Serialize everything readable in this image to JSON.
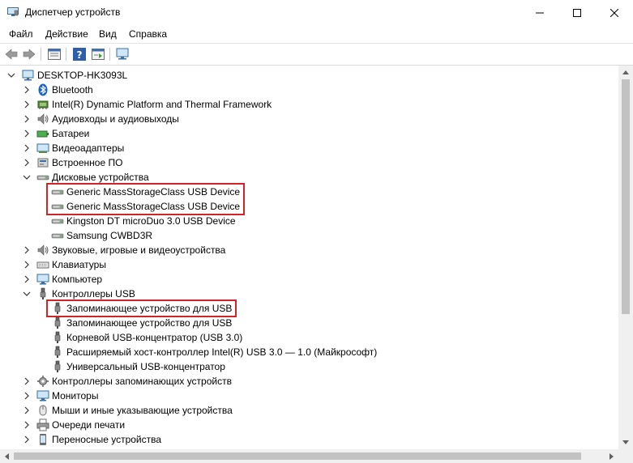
{
  "window": {
    "title": "Диспетчер устройств",
    "controls": {
      "minimize": "─",
      "maximize": "☐",
      "close": "✕"
    }
  },
  "menu": [
    {
      "label": "Файл"
    },
    {
      "label": "Действие"
    },
    {
      "label": "Вид"
    },
    {
      "label": "Справка"
    }
  ],
  "toolbar": [
    "back-arrow-icon",
    "forward-arrow-icon",
    "properties-icon",
    "help-icon",
    "update-driver-icon",
    "computer-monitor-icon"
  ],
  "tree": {
    "root": {
      "label": "DESKTOP-HK3093L",
      "icon": "computer-icon"
    },
    "items": [
      {
        "label": "Bluetooth",
        "icon": "bluetooth-icon",
        "expanded": false
      },
      {
        "label": "Intel(R) Dynamic Platform and Thermal Framework",
        "icon": "chip-icon",
        "expanded": false
      },
      {
        "label": "Аудиовходы и аудиовыходы",
        "icon": "speaker-icon",
        "expanded": false
      },
      {
        "label": "Батареи",
        "icon": "battery-icon",
        "expanded": false
      },
      {
        "label": "Видеоадаптеры",
        "icon": "display-adapter-icon",
        "expanded": false
      },
      {
        "label": "Встроенное ПО",
        "icon": "firmware-icon",
        "expanded": false
      },
      {
        "label": "Дисковые устройства",
        "icon": "disk-drive-icon",
        "expanded": true,
        "children": [
          {
            "label": "Generic MassStorageClass USB Device",
            "icon": "disk-drive-icon"
          },
          {
            "label": "Generic MassStorageClass USB Device",
            "icon": "disk-drive-icon"
          },
          {
            "label": "Kingston DT microDuo 3.0 USB Device",
            "icon": "disk-drive-icon"
          },
          {
            "label": "Samsung CWBD3R",
            "icon": "disk-drive-icon"
          }
        ]
      },
      {
        "label": "Звуковые, игровые и видеоустройства",
        "icon": "speaker-icon",
        "expanded": false
      },
      {
        "label": "Клавиатуры",
        "icon": "keyboard-icon",
        "expanded": false
      },
      {
        "label": "Компьютер",
        "icon": "monitor-icon",
        "expanded": false
      },
      {
        "label": "Контроллеры USB",
        "icon": "usb-icon",
        "expanded": true,
        "children": [
          {
            "label": "Запоминающее устройство для USB",
            "icon": "usb-plug-icon"
          },
          {
            "label": "Запоминающее устройство для USB",
            "icon": "usb-plug-icon"
          },
          {
            "label": "Корневой USB-концентратор (USB 3.0)",
            "icon": "usb-plug-icon"
          },
          {
            "label": "Расширяемый хост-контроллер Intel(R) USB 3.0 — 1.0 (Майкрософт)",
            "icon": "usb-plug-icon"
          },
          {
            "label": "Универсальный USB-концентратор",
            "icon": "usb-plug-icon"
          }
        ]
      },
      {
        "label": "Контроллеры запоминающих устройств",
        "icon": "storage-controller-icon",
        "expanded": false
      },
      {
        "label": "Мониторы",
        "icon": "monitor-icon",
        "expanded": false
      },
      {
        "label": "Мыши и иные указывающие устройства",
        "icon": "mouse-icon",
        "expanded": false
      },
      {
        "label": "Очереди печати",
        "icon": "printer-icon",
        "expanded": false
      },
      {
        "label": "Переносные устройства",
        "icon": "portable-device-icon",
        "expanded": false
      }
    ]
  },
  "highlight_color": "#d1232a",
  "vscroll_fraction_visible": 0.66,
  "hscroll_fraction_visible": 0.96
}
